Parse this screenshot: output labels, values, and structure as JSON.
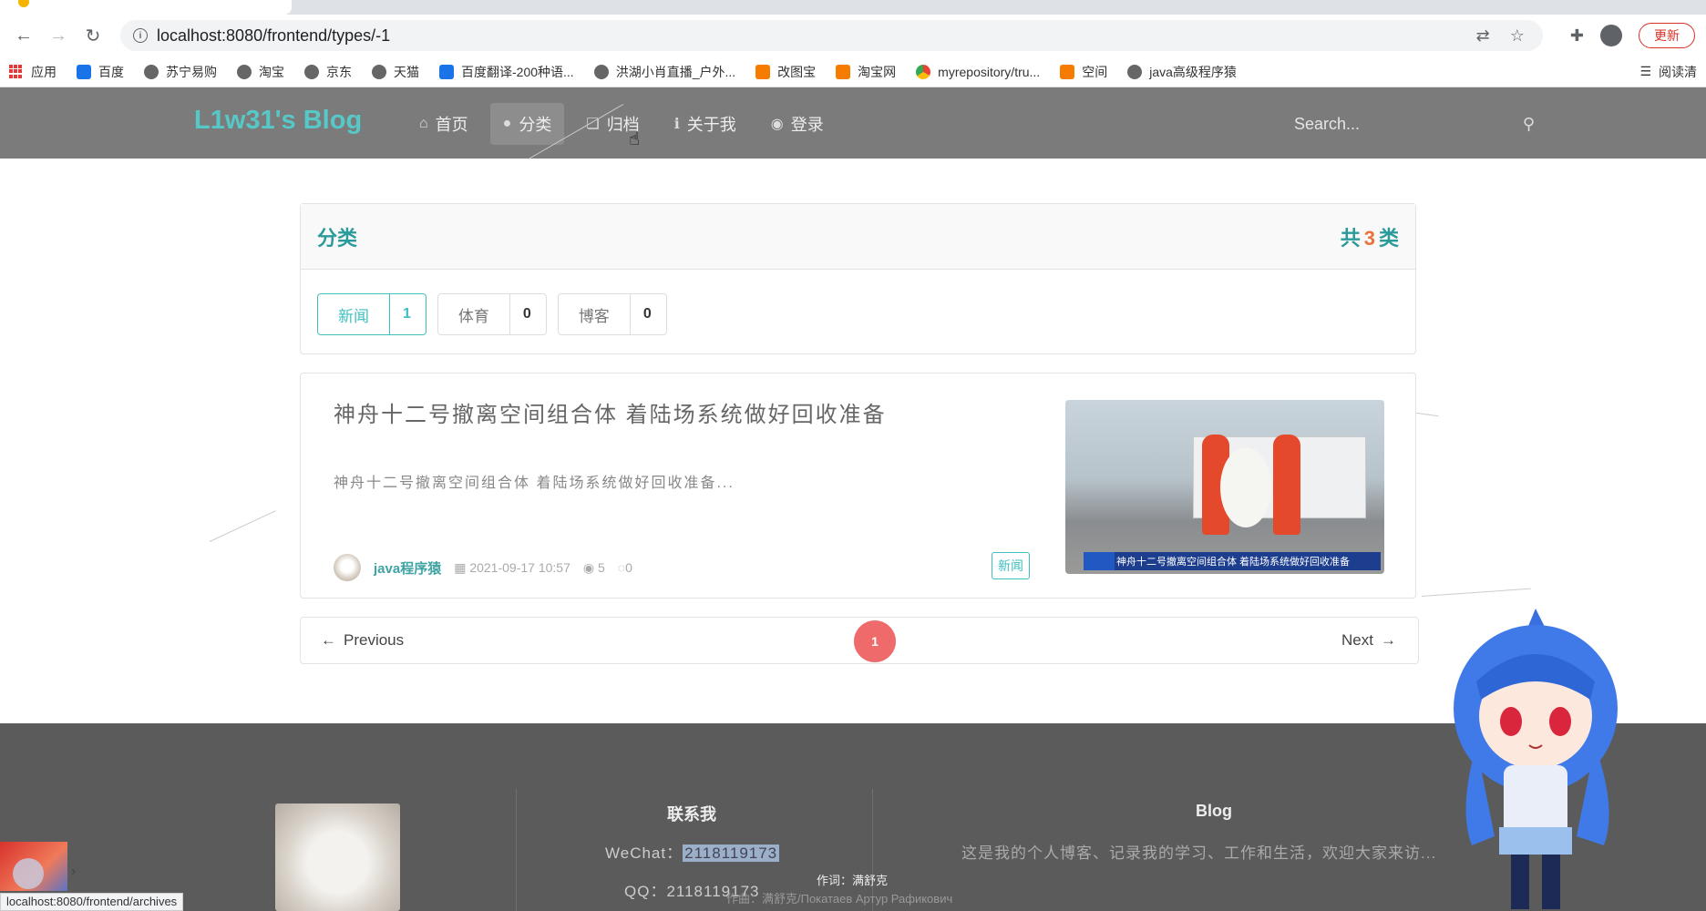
{
  "browser": {
    "url": "localhost:8080/frontend/types/-1",
    "update_label": "更新",
    "bookmarks": [
      {
        "label": "应用",
        "icon": "apps-grid-icon"
      },
      {
        "label": "百度",
        "icon": "baidu-icon"
      },
      {
        "label": "苏宁易购",
        "icon": "globe-icon"
      },
      {
        "label": "淘宝",
        "icon": "globe-icon"
      },
      {
        "label": "京东",
        "icon": "globe-icon"
      },
      {
        "label": "天猫",
        "icon": "globe-icon"
      },
      {
        "label": "百度翻译-200种语...",
        "icon": "translate-icon"
      },
      {
        "label": "洪湖小肖直播_户外...",
        "icon": "bird-icon"
      },
      {
        "label": "改图宝",
        "icon": "image-tool-icon"
      },
      {
        "label": "淘宝网",
        "icon": "taobao-icon"
      },
      {
        "label": "myrepository/tru...",
        "icon": "chrome-icon"
      },
      {
        "label": "空间",
        "icon": "qzone-icon"
      },
      {
        "label": "java高级程序猿",
        "icon": "bilibili-icon"
      }
    ],
    "reading_list": "阅读清"
  },
  "site": {
    "brand": "L1w31's Blog",
    "menu": [
      {
        "label": "首页",
        "icon": "home-icon"
      },
      {
        "label": "分类",
        "icon": "lightbulb-icon"
      },
      {
        "label": "归档",
        "icon": "archive-icon"
      },
      {
        "label": "关于我",
        "icon": "info-icon"
      },
      {
        "label": "登录",
        "icon": "user-icon"
      }
    ],
    "active_menu": "分类",
    "search_placeholder": "Search..."
  },
  "category_panel": {
    "title": "分类",
    "total_prefix": "共",
    "total_count": "3",
    "total_suffix": "类",
    "labels": [
      {
        "name": "新闻",
        "count": "1",
        "active": true
      },
      {
        "name": "体育",
        "count": "0",
        "active": false
      },
      {
        "name": "博客",
        "count": "0",
        "active": false
      }
    ]
  },
  "post": {
    "title": "神舟十二号撤离空间组合体 着陆场系统做好回收准备",
    "excerpt": "神舟十二号撤离空间组合体 着陆场系统做好回收准备...",
    "author": "java程序猿",
    "date": "2021-09-17 10:57",
    "views": "5",
    "comments": "0",
    "tag": "新闻",
    "thumb_caption": "神舟十二号撤离空间组合体 着陆场系统做好回收准备"
  },
  "pagination": {
    "prev": "Previous",
    "next": "Next",
    "current": "1"
  },
  "footer": {
    "contact_title": "联系我",
    "wechat_label": "WeChat：",
    "wechat": "2118119173",
    "qq_label": "QQ：",
    "qq": "2118119173",
    "blog_title": "Blog",
    "blog_desc": "这是我的个人博客、记录我的学习、工作和生活，欢迎大家来访...",
    "lyric_line1": "作词：满舒克",
    "lyric_line2": "作曲：满舒克/Покатаев Артур Рафикович"
  },
  "status_url": "localhost:8080/frontend/archives"
}
